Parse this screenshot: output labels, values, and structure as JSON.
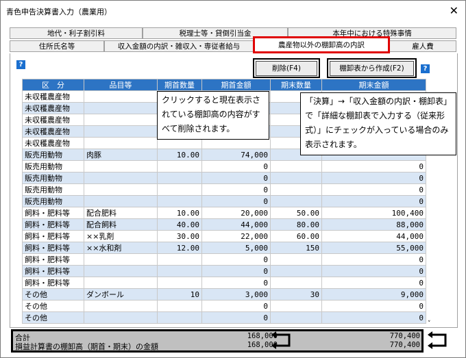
{
  "window": {
    "title": "青色申告決算書入力（農業用）",
    "close_glyph": "✕"
  },
  "tabs": {
    "row1": [
      "地代・利子割引料",
      "税理士等・貸倒引当金",
      "本年中における特殊事情"
    ],
    "row2": [
      "住所氏名等",
      "収入金額の内訳・雑収入・専従者給与",
      "農産物以外の棚卸高の内訳",
      "雇人費"
    ],
    "active": "農産物以外の棚卸高の内訳"
  },
  "help_glyph": "?",
  "buttons": {
    "delete": "削除(F4)",
    "create_from_inventory": "棚卸表から作成(F2)"
  },
  "callouts": {
    "delete_note": "クリックすると現在表示されている棚卸高の内容がすべて削除されます。",
    "create_note": "「決算」→「収入金額の内訳・棚卸表」で「詳細な棚卸表で入力する（従来形式）」にチェックが入っている場合のみ表示されます。"
  },
  "table": {
    "headers": [
      "区　分",
      "品目等",
      "期首数量",
      "期首金額",
      "期末数量",
      "期末金額"
    ],
    "rows": [
      {
        "cat": "未収穫農産物",
        "item": "",
        "q1": "",
        "a1": "",
        "q2": "",
        "a2": "",
        "ind": false
      },
      {
        "cat": "未収穫農産物",
        "item": "",
        "q1": "",
        "a1": "",
        "q2": "",
        "a2": "",
        "ind": false
      },
      {
        "cat": "未収穫農産物",
        "item": "",
        "q1": "",
        "a1": "",
        "q2": "",
        "a2": "",
        "ind": false
      },
      {
        "cat": "未収穫農産物",
        "item": "",
        "q1": "",
        "a1": "",
        "q2": "",
        "a2": "",
        "ind": false
      },
      {
        "cat": "未収穫農産物",
        "item": "",
        "q1": "",
        "a1": "",
        "q2": "",
        "a2": "",
        "ind": false
      },
      {
        "cat": "販売用動物",
        "item": "肉豚",
        "q1": "10.00",
        "a1": "74,000",
        "q2": "",
        "a2": "",
        "ind": true
      },
      {
        "cat": "販売用動物",
        "item": "",
        "q1": "",
        "a1": "0",
        "q2": "",
        "a2": "0",
        "ind": true
      },
      {
        "cat": "販売用動物",
        "item": "",
        "q1": "",
        "a1": "0",
        "q2": "",
        "a2": "0",
        "ind": true
      },
      {
        "cat": "販売用動物",
        "item": "",
        "q1": "",
        "a1": "0",
        "q2": "",
        "a2": "0",
        "ind": true
      },
      {
        "cat": "販売用動物",
        "item": "",
        "q1": "",
        "a1": "0",
        "q2": "",
        "a2": "0",
        "ind": true
      },
      {
        "cat": "飼料・肥料等",
        "item": "配合肥料",
        "q1": "10.00",
        "a1": "20,000",
        "q2": "50.00",
        "a2": "100,400",
        "ind": false
      },
      {
        "cat": "飼料・肥料等",
        "item": "配合飼料",
        "q1": "40.00",
        "a1": "44,000",
        "q2": "80.00",
        "a2": "88,000",
        "ind": false
      },
      {
        "cat": "飼料・肥料等",
        "item": "××乳剤",
        "q1": "30.00",
        "a1": "22,000",
        "q2": "60.00",
        "a2": "44,000",
        "ind": false
      },
      {
        "cat": "飼料・肥料等",
        "item": "××水和剤",
        "q1": "12.00",
        "a1": "5,000",
        "q2": "150",
        "a2": "55,000",
        "ind": false
      },
      {
        "cat": "飼料・肥料等",
        "item": "",
        "q1": "",
        "a1": "0",
        "q2": "",
        "a2": "0",
        "ind": false
      },
      {
        "cat": "飼料・肥料等",
        "item": "",
        "q1": "",
        "a1": "0",
        "q2": "",
        "a2": "0",
        "ind": false
      },
      {
        "cat": "飼料・肥料等",
        "item": "",
        "q1": "",
        "a1": "0",
        "q2": "",
        "a2": "0",
        "ind": false
      },
      {
        "cat": "その他",
        "item": "ダンボール",
        "q1": "10",
        "a1": "3,000",
        "q2": "30",
        "a2": "9,000",
        "ind": true
      },
      {
        "cat": "その他",
        "item": "",
        "q1": "",
        "a1": "0",
        "q2": "",
        "a2": "0",
        "ind": true
      },
      {
        "cat": "その他",
        "item": "",
        "q1": "",
        "a1": "0",
        "q2": "",
        "a2": "0",
        "ind": true
      }
    ]
  },
  "footer": {
    "total_label": "合計",
    "total_begin": "168,000",
    "total_end": "770,400",
    "pl_label": "損益計算書の棚卸高（期首・期末）の金額",
    "pl_begin": "168,000",
    "pl_end": "770,400"
  },
  "scroll_glyph": "˅"
}
